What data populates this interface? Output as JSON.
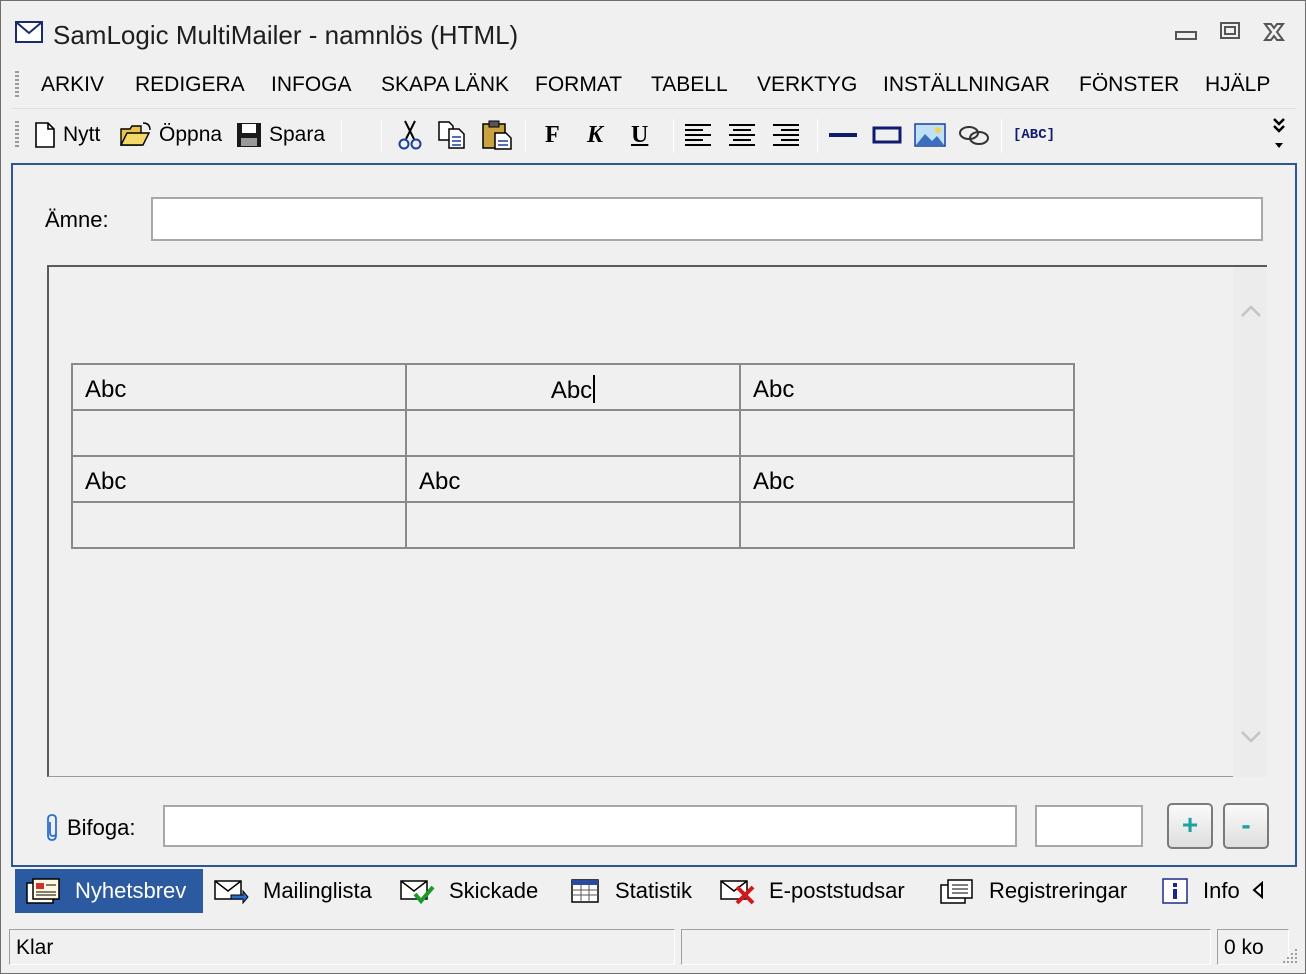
{
  "window": {
    "title": "SamLogic MultiMailer - namnlös  (HTML)"
  },
  "menu": [
    "ARKIV",
    "REDIGERA",
    "INFOGA",
    "SKAPA LÄNK",
    "FORMAT",
    "TABELL",
    "VERKTYG",
    "INSTÄLLNINGAR",
    "FÖNSTER",
    "HJÄLP"
  ],
  "toolbar": {
    "new_label": "Nytt",
    "open_label": "Öppna",
    "save_label": "Spara",
    "bold_glyph": "F",
    "italic_glyph": "K",
    "underline_glyph": "U",
    "spell_glyph": "[ABC]"
  },
  "form": {
    "subject_label": "Ämne:",
    "subject_value": "",
    "attach_label": "Bifoga:",
    "attach_value": "",
    "size_value": "",
    "add_label": "+",
    "remove_label": "-"
  },
  "editor": {
    "table": [
      [
        "Abc",
        "Abc",
        "Abc"
      ],
      [
        "",
        "",
        ""
      ],
      [
        "Abc",
        "Abc",
        "Abc"
      ],
      [
        "",
        "",
        ""
      ]
    ]
  },
  "tabs": [
    {
      "label": "Nyhetsbrev",
      "icon": "newsletter-icon",
      "active": true
    },
    {
      "label": "Mailinglista",
      "icon": "mailing-list-icon",
      "active": false
    },
    {
      "label": "Skickade",
      "icon": "sent-icon",
      "active": false
    },
    {
      "label": "Statistik",
      "icon": "statistics-icon",
      "active": false
    },
    {
      "label": "E-poststudsar",
      "icon": "bounce-icon",
      "active": false
    },
    {
      "label": "Registreringar",
      "icon": "registrations-icon",
      "active": false
    },
    {
      "label": "Info",
      "icon": "info-icon",
      "active": false
    }
  ],
  "status": {
    "left": "Klar",
    "middle": "",
    "right": "0 ko"
  },
  "colors": {
    "accent": "#2c5aa0",
    "plus_minus": "#1da1a1"
  }
}
